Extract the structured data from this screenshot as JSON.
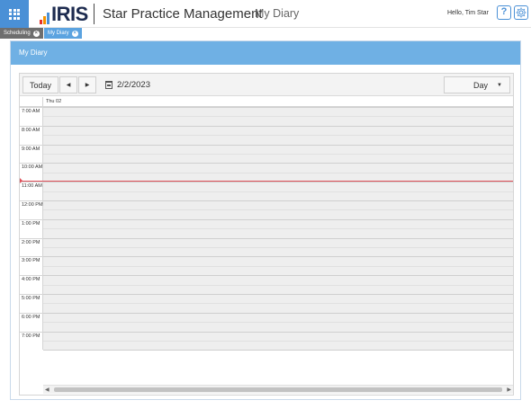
{
  "header": {
    "logo_text": "IRIS",
    "app_title": "Star Practice Management",
    "page_subtitle": "My Diary",
    "greeting": "Hello, Tim Star",
    "help_label": "?",
    "apps_icon": "apps-grid-icon",
    "settings_icon": "gear-icon",
    "brand_colors": [
      "#e5332a",
      "#f39200",
      "#4a90d6"
    ]
  },
  "tabs": [
    {
      "label": "Scheduling",
      "active": false
    },
    {
      "label": "My Diary",
      "active": true
    }
  ],
  "panel": {
    "title": "My Diary",
    "header_color": "#6fb0e4"
  },
  "toolbar": {
    "today_label": "Today",
    "prev_label": "◀",
    "next_label": "▶",
    "date": "2/2/2023",
    "view": "Day"
  },
  "day_header": {
    "label": "Thu 02"
  },
  "time_slots": [
    "7:00 AM",
    "8:00 AM",
    "9:00 AM",
    "10:00 AM",
    "11:00 AM",
    "12:00 PM",
    "1:00 PM",
    "2:00 PM",
    "3:00 PM",
    "4:00 PM",
    "5:00 PM",
    "6:00 PM",
    "7:00 PM"
  ],
  "now_indicator_color": "#e0505a"
}
